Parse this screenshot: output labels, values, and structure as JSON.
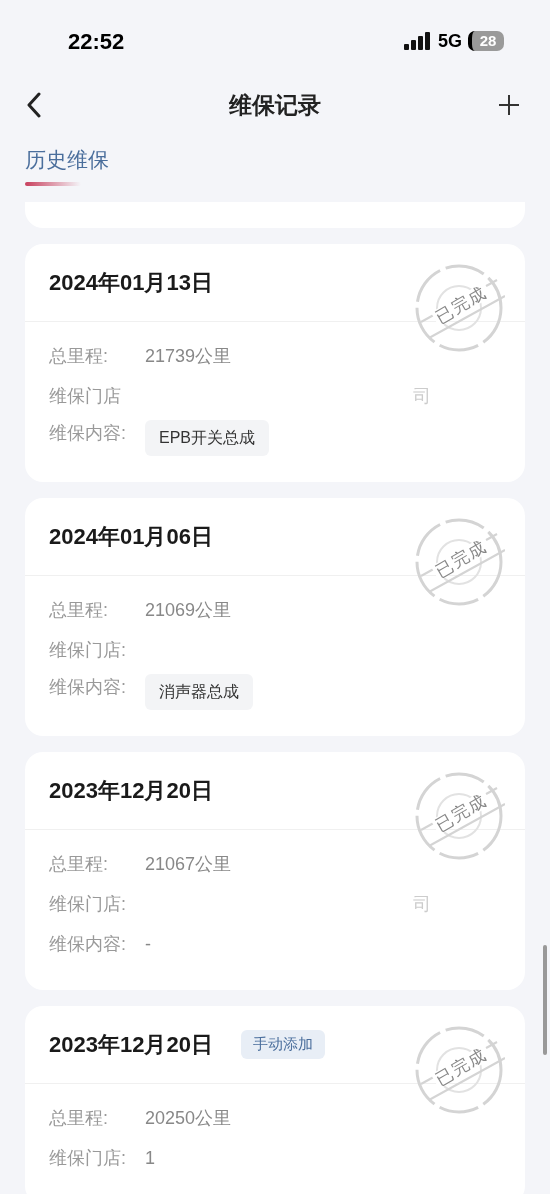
{
  "status_bar": {
    "time": "22:52",
    "network": "5G",
    "battery": "28"
  },
  "nav": {
    "title": "维保记录"
  },
  "tabs": [
    {
      "label": "历史维保",
      "selected": true
    }
  ],
  "records": [
    {
      "date": "2024年01月13日",
      "status": "已完成",
      "rows": [
        {
          "kind": "text",
          "label": "总里程:",
          "value": "21739公里"
        },
        {
          "kind": "masked",
          "label": "维保门店",
          "value": "司"
        },
        {
          "kind": "chips",
          "label": "维保内容:",
          "chips": [
            "EPB开关总成"
          ]
        }
      ]
    },
    {
      "date": "2024年01月06日",
      "status": "已完成",
      "rows": [
        {
          "kind": "text",
          "label": "总里程:",
          "value": "21069公里"
        },
        {
          "kind": "text",
          "label": "维保门店:"
        },
        {
          "kind": "chips",
          "label": "维保内容:",
          "chips": [
            "消声器总成"
          ]
        }
      ]
    },
    {
      "date": "2023年12月20日",
      "status": "已完成",
      "rows": [
        {
          "kind": "text",
          "label": "总里程:",
          "value": "21067公里"
        },
        {
          "kind": "masked",
          "label": "维保门店:",
          "value": "司"
        },
        {
          "kind": "text",
          "label": "维保内容:",
          "value": "-"
        }
      ]
    },
    {
      "date": "2023年12月20日",
      "tag": "手动添加",
      "status": "已完成",
      "rows": [
        {
          "kind": "text",
          "label": "总里程:",
          "value": "20250公里"
        },
        {
          "kind": "text",
          "label": "维保门店:",
          "value": "1"
        }
      ]
    }
  ]
}
